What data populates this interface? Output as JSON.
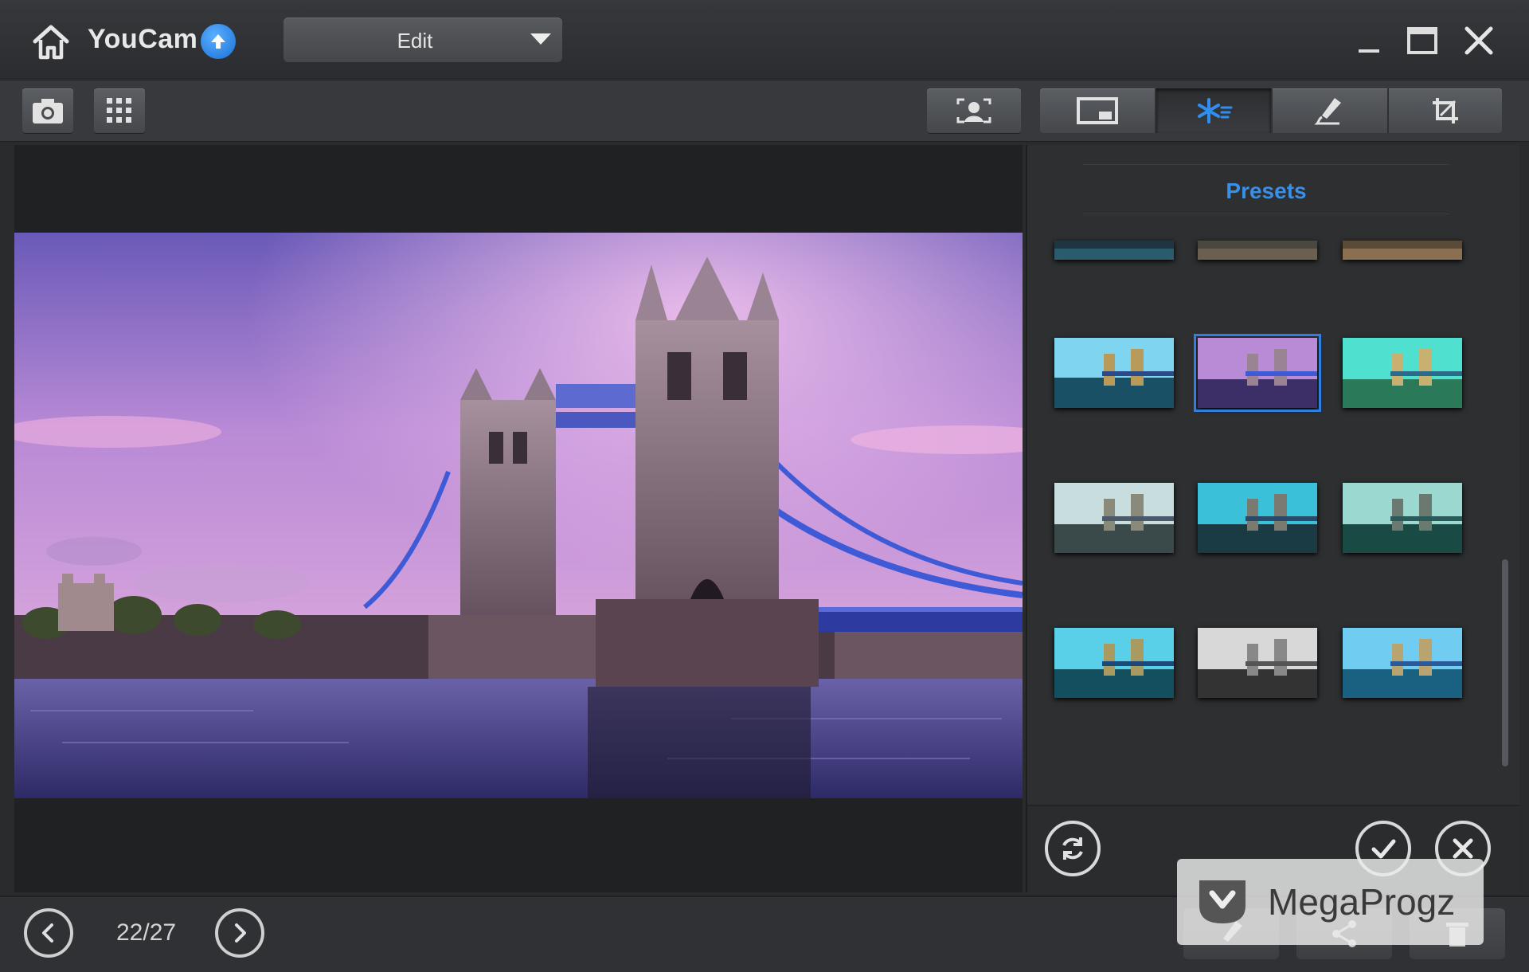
{
  "app": {
    "name": "YouCam",
    "mode": "Edit"
  },
  "panel": {
    "title": "Presets",
    "thumbnails": [
      {
        "style": "dark-teal"
      },
      {
        "style": "dark-warm"
      },
      {
        "style": "dark-gold"
      },
      {
        "style": "cyan-warm"
      },
      {
        "style": "purple-selected"
      },
      {
        "style": "teal-bright"
      },
      {
        "style": "pale-cool"
      },
      {
        "style": "deep-teal"
      },
      {
        "style": "cyan-faded"
      },
      {
        "style": "cyan-saturated"
      },
      {
        "style": "monochrome"
      },
      {
        "style": "sky-blue"
      }
    ],
    "selected_index": 4
  },
  "navigation": {
    "counter": "22/27"
  },
  "watermark": {
    "text": "MegaProgz"
  },
  "colors": {
    "accent": "#2f7fe0",
    "panel_title": "#3b8fe6",
    "background": "#2a2b2d"
  },
  "icons": {
    "home": "home-icon",
    "update": "arrow-up-icon",
    "minimize": "minimize-icon",
    "maximize": "maximize-icon",
    "close": "close-icon",
    "camera": "camera-icon",
    "grid": "grid-icon",
    "face": "face-icon",
    "frame": "frame-icon",
    "effects": "sparkle-icon",
    "brush": "brush-icon",
    "crop": "crop-icon",
    "reset": "refresh-icon",
    "apply": "check-icon",
    "cancel": "cancel-icon",
    "prev": "chevron-left-icon",
    "next": "chevron-right-icon",
    "share": "share-icon"
  }
}
